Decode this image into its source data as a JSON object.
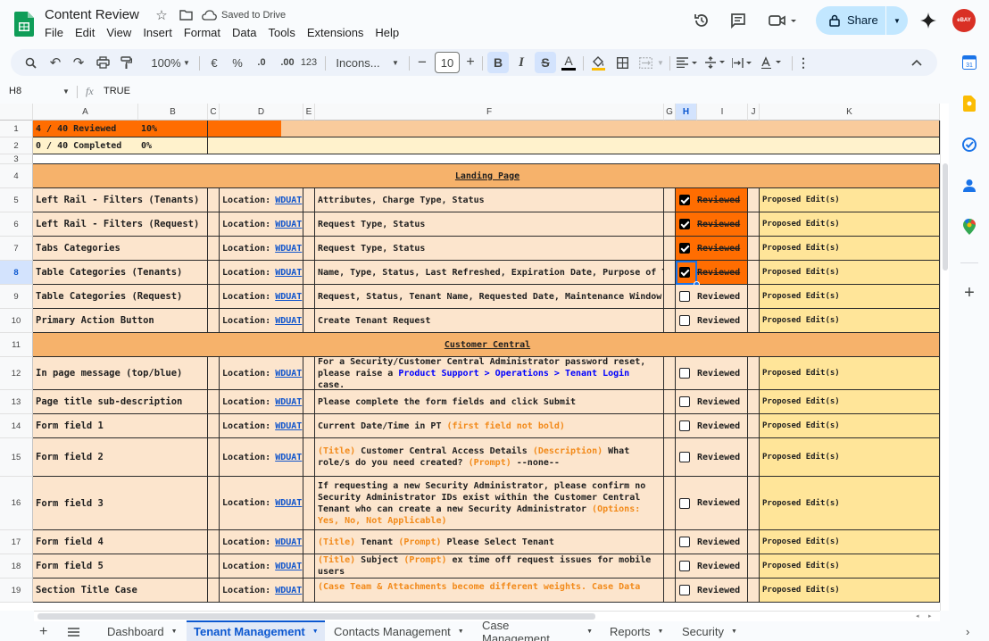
{
  "doc": {
    "title": "Content Review",
    "saved": "Saved to Drive"
  },
  "menu": [
    "File",
    "Edit",
    "View",
    "Insert",
    "Format",
    "Data",
    "Tools",
    "Extensions",
    "Help"
  ],
  "toolbar": {
    "zoom": "100%",
    "currency": "€",
    "percent": "%",
    "dec_less": ".0",
    "dec_more": ".00",
    "format123": "123",
    "font": "Incons...",
    "font_size": "10",
    "bold": "B",
    "italic": "I",
    "strike": "S",
    "text_color": "A",
    "fill_color": "#fbbc04"
  },
  "share": {
    "label": "Share"
  },
  "avatar": {
    "text": "eBAY"
  },
  "formula": {
    "cell_ref": "H8",
    "fx": "fx",
    "value": "TRUE"
  },
  "columns": [
    "A",
    "B",
    "C",
    "D",
    "E",
    "F",
    "G",
    "H",
    "I",
    "J",
    "K"
  ],
  "rows_labels": [
    "1",
    "2",
    "3",
    "4",
    "5",
    "6",
    "7",
    "8",
    "9",
    "10",
    "11",
    "12",
    "13",
    "14",
    "15",
    "16",
    "17",
    "18",
    "19"
  ],
  "summary": {
    "reviewed": "4 / 40 Reviewed",
    "reviewed_pct": "10%",
    "completed": "0 / 40 Completed",
    "completed_pct": "0%",
    "reviewed_fraction": 0.1
  },
  "sections": {
    "landing": "Landing Page",
    "customer": "Customer Central"
  },
  "loc_label": "Location:",
  "loc_link": "WDUAT",
  "checkbox_label": "Reviewed",
  "edit_label": "Proposed Edit(s)",
  "items": [
    {
      "name": "Left Rail - Filters (Tenants)",
      "desc": "Attributes, Charge Type, Status",
      "checked": true
    },
    {
      "name": "Left Rail - Filters (Request)",
      "desc": "Request Type, Status",
      "checked": true
    },
    {
      "name": "Tabs Categories",
      "desc": "Request Type, Status",
      "checked": true
    },
    {
      "name": "Table Categories (Tenants)",
      "desc": "Name, Type, Status, Last Refreshed, Expiration Date, Purpose of Tenant",
      "checked": true
    },
    {
      "name": "Table Categories (Request)",
      "desc": "Request, Status, Tenant Name, Requested Date, Maintenance Window",
      "checked": false
    },
    {
      "name": "Primary Action Button",
      "desc": "Create Tenant Request",
      "checked": false
    },
    {
      "name": "In page message (top/blue)",
      "checked": false,
      "desc_parts": [
        {
          "t": "For a Security/Customer Central Administrator password reset, please raise a "
        },
        {
          "t": "Product Support > Operations > Tenant Login",
          "c": "b"
        },
        {
          "t": " case."
        }
      ]
    },
    {
      "name": "Page title sub-description",
      "desc": "Please complete the form fields and click Submit",
      "checked": false
    },
    {
      "name": "Form field 1",
      "checked": false,
      "desc_parts": [
        {
          "t": "Current Date/Time in PT "
        },
        {
          "t": "(first field not bold)",
          "c": "o"
        }
      ]
    },
    {
      "name": "Form field 2",
      "checked": false,
      "desc_parts": [
        {
          "t": "(Title)",
          "c": "o"
        },
        {
          "t": " Customer Central Access Details "
        },
        {
          "t": "(Description)",
          "c": "o"
        },
        {
          "t": " What role/s do you need created? "
        },
        {
          "t": "(Prompt)",
          "c": "o"
        },
        {
          "t": " --none--"
        }
      ]
    },
    {
      "name": "Form field 3",
      "checked": false,
      "desc_parts": [
        {
          "t": "If requesting a new Security Administrator, please confirm no Security Administrator IDs exist within the Customer Central Tenant who can create a new Security Administrator "
        },
        {
          "t": "(Options: Yes, No, Not Applicable)",
          "c": "o"
        }
      ]
    },
    {
      "name": "Form field 4",
      "checked": false,
      "desc_parts": [
        {
          "t": "(Title)",
          "c": "o"
        },
        {
          "t": " Tenant "
        },
        {
          "t": "(Prompt)",
          "c": "o"
        },
        {
          "t": " Please Select Tenant"
        }
      ]
    },
    {
      "name": "Form field 5",
      "checked": false,
      "desc_parts": [
        {
          "t": "(Title)",
          "c": "o"
        },
        {
          "t": " Subject "
        },
        {
          "t": "(Prompt)",
          "c": "o"
        },
        {
          "t": " ex time off request issues for mobile users"
        }
      ]
    },
    {
      "name": "Section Title Case",
      "checked": false,
      "desc_parts": [
        {
          "t": "(Case Team & Attachments become different weights. Case Data",
          "c": "o"
        }
      ]
    }
  ],
  "sheets": [
    {
      "name": "Dashboard",
      "active": false
    },
    {
      "name": "Tenant Management",
      "active": true
    },
    {
      "name": "Contacts Management",
      "active": false
    },
    {
      "name": "Case Management",
      "active": false
    },
    {
      "name": "Reports",
      "active": false
    },
    {
      "name": "Security",
      "active": false
    }
  ],
  "colors": {
    "orange": "#ff6d01",
    "light_orange": "#f9cb9c",
    "peach": "#fce5cd",
    "mid_orange": "#f6b26b",
    "yellow": "#ffe599",
    "pale_yellow": "#fff2cc",
    "header_orange": "#f6b26b"
  }
}
